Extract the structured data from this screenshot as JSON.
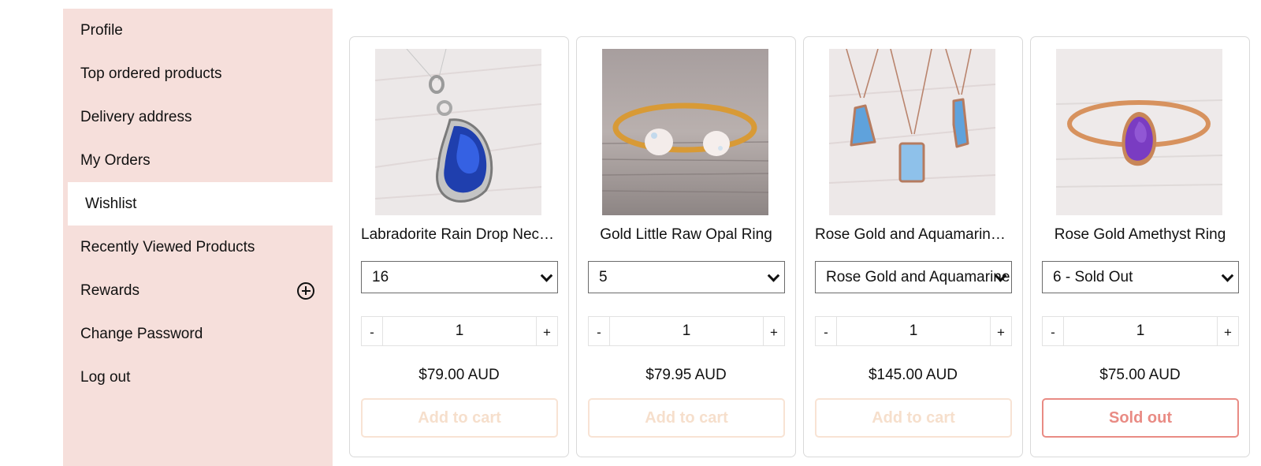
{
  "sidebar": {
    "items": [
      {
        "label": "Profile"
      },
      {
        "label": "Top ordered products"
      },
      {
        "label": "Delivery address"
      },
      {
        "label": "My Orders"
      },
      {
        "label": "Wishlist",
        "active": true
      },
      {
        "label": "Recently Viewed Products"
      },
      {
        "label": "Rewards",
        "icon": "plus-circle-icon"
      },
      {
        "label": "Change Password"
      },
      {
        "label": "Log out"
      }
    ]
  },
  "products": [
    {
      "title": "Labradorite Rain Drop Necklace",
      "image": "labradorite-pendant-image",
      "variant": "16",
      "quantity": "1",
      "price": "$79.00 AUD",
      "button": "Add to cart",
      "button_state": "disabled"
    },
    {
      "title": "Gold Little Raw Opal Ring",
      "image": "opal-ring-image",
      "variant": "5",
      "quantity": "1",
      "price": "$79.95 AUD",
      "button": "Add to cart",
      "button_state": "disabled"
    },
    {
      "title": "Rose Gold and Aquamarine Necklace",
      "image": "aquamarine-necklaces-image",
      "variant": "Rose Gold and Aquamarine",
      "quantity": "1",
      "price": "$145.00 AUD",
      "button": "Add to cart",
      "button_state": "disabled"
    },
    {
      "title": "Rose Gold Amethyst Ring",
      "image": "amethyst-ring-image",
      "variant": "6 - Sold Out",
      "quantity": "1",
      "price": "$75.00 AUD",
      "button": "Sold out",
      "button_state": "sold-out"
    }
  ],
  "qty_controls": {
    "minus": "-",
    "plus": "+"
  },
  "colors": {
    "sidebar_bg": "#f6dfdb",
    "disabled_button": "#f6dfcc",
    "sold_out": "#e98b84"
  }
}
